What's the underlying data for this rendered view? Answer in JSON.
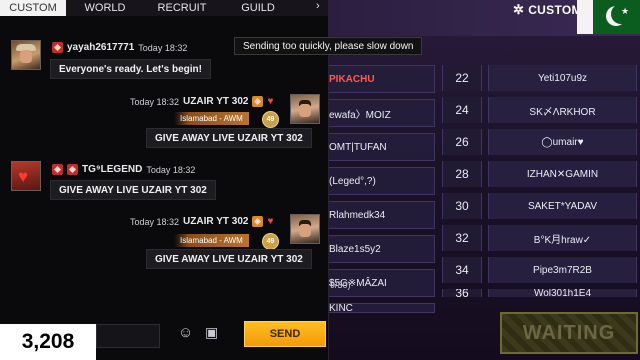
{
  "tabs": [
    {
      "label": "CUSTOM",
      "active": true
    },
    {
      "label": "WORLD",
      "active": false
    },
    {
      "label": "RECRUIT",
      "active": false
    },
    {
      "label": "GUILD",
      "active": false
    }
  ],
  "tab_arrow": "›",
  "warning": "Sending too quickly, please slow down",
  "messages": [
    {
      "name": "yayah2617771",
      "time": "Today 18:32",
      "text": "Everyone's ready. Let's begin!"
    },
    {
      "name": "UZAIR YT 302",
      "time": "Today 18:32",
      "location": "Islamabad - AWM",
      "level": "49",
      "text": "GIVE AWAY LIVE UZAIR YT 302"
    },
    {
      "name": "TG⁹LEGEND",
      "time": "Today 18:32",
      "text": "GIVE AWAY LIVE UZAIR YT 302"
    },
    {
      "name": "UZAIR YT 302",
      "time": "Today 18:32",
      "location": "Islamabad - AWM",
      "level": "49",
      "text": "GIVE AWAY LIVE UZAIR YT 302"
    }
  ],
  "input": {
    "send_label": "SEND",
    "emoji_icon": "emoji-icon",
    "quick_icon": "quick-message-icon"
  },
  "viewer_count": "3,208",
  "room": {
    "mode_label": "CUSTOM",
    "left_slots": [
      "PIKACHU",
      "ewafa〉MOIZ",
      "OMT|TUFAN",
      "(Leged°,?)",
      "Rlahmedk34",
      "Blaze1s5y2",
      "$5G※MÂZAI",
      "KINC"
    ],
    "slot_count": "9/30)",
    "right_slots": [
      {
        "num": "22",
        "name": "Yeti107u9z"
      },
      {
        "num": "24",
        "name": "SK〆ΛRKHOR"
      },
      {
        "num": "26",
        "name": "◯umair♥"
      },
      {
        "num": "28",
        "name": "IZHAN✕GAMIN"
      },
      {
        "num": "30",
        "name": "SAKET*YADAV"
      },
      {
        "num": "32",
        "name": "B°K月hraw✓"
      },
      {
        "num": "34",
        "name": "Pipe3m7R2B"
      },
      {
        "num": "36",
        "name": "Wol301h1E4"
      }
    ],
    "waiting_label": "WAITING"
  },
  "colors": {
    "accent": "#f5a417",
    "tab_active_bg": "#f2f2f2",
    "panel_bg": "#0a0a0d",
    "room_bg": "#1b1228"
  }
}
